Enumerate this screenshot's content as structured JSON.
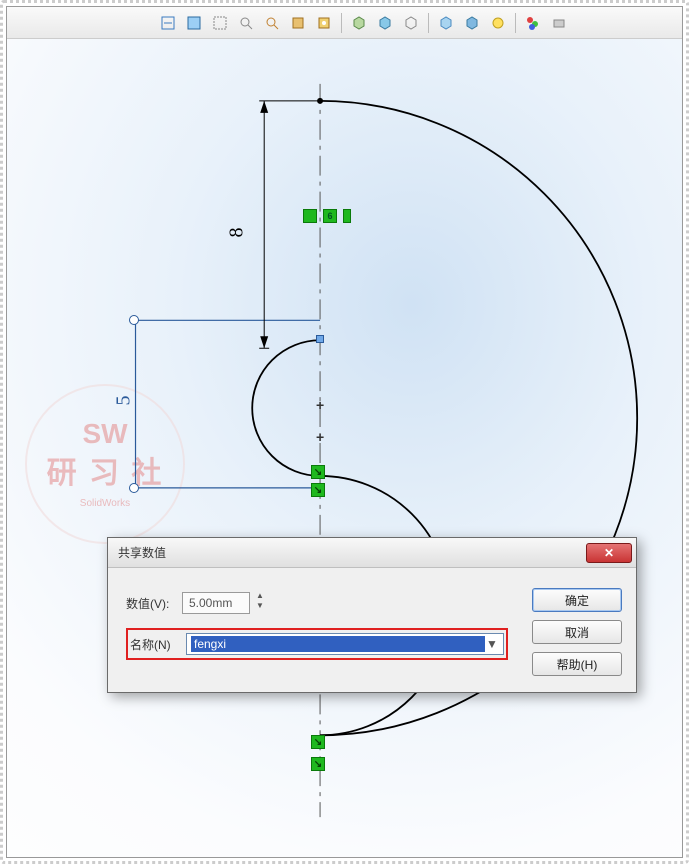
{
  "toolbar": {
    "icons": [
      "view-refresh",
      "view-front",
      "view-section",
      "zoom-fit",
      "zoom-window",
      "pan",
      "rotate",
      "shaded",
      "shaded-edges",
      "wireframe",
      "hidden-removed",
      "hidden-visible",
      "perspective",
      "shadow",
      "apply-color",
      "view-orientation",
      "display"
    ]
  },
  "watermark": {
    "line1": "SW",
    "line2": "研 习 社",
    "line3": "SolidWorks"
  },
  "sketch": {
    "dim_vertical_main": "8",
    "dim_vertical_secondary": "5",
    "badge_small": "6"
  },
  "dialog": {
    "title": "共享数值",
    "value_label": "数值(V):",
    "value": "5.00mm",
    "name_label": "名称(N)",
    "name_value": "fengxi",
    "ok": "确定",
    "cancel": "取消",
    "help": "帮助(H)",
    "close_symbol": "✕"
  }
}
